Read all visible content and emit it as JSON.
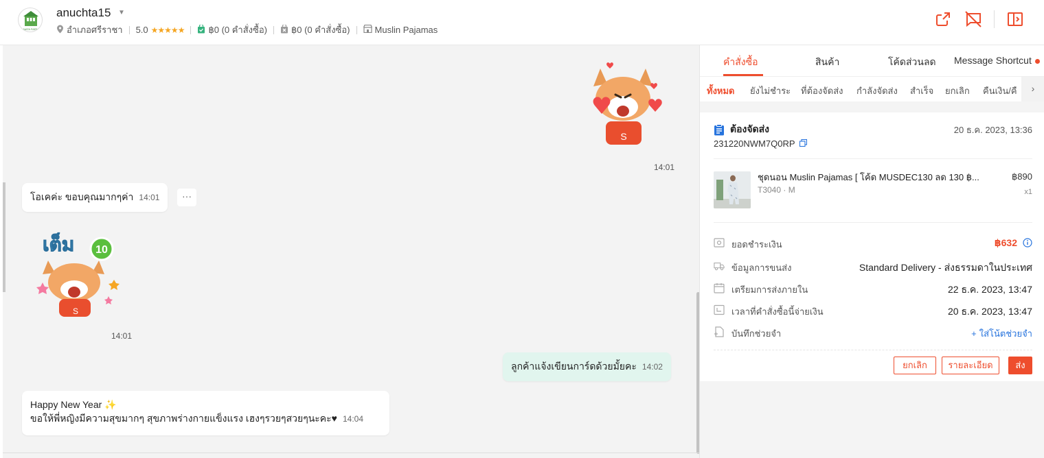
{
  "header": {
    "shop_name": "anuchta15",
    "shop_logo_text": "NATA FARM",
    "location": "อำเภอศรีราชา",
    "rating": "5.0",
    "paid_orders": "฿0 (0 คำสั่งซื้อ)",
    "cancelled_orders": "฿0 (0 คำสั่งซื้อ)",
    "shop_category": "Muslin Pajamas"
  },
  "chat": {
    "messages": [
      {
        "type": "sticker",
        "side": "out",
        "time": "14:01",
        "sticker_text": "S"
      },
      {
        "type": "text",
        "side": "in",
        "text": "โอเคค่ะ ขอบคุณมากๆค่า",
        "time": "14:01"
      },
      {
        "type": "sticker",
        "side": "in",
        "time": "14:01",
        "sticker_text": "เต็ม",
        "sticker_number": "10",
        "sticker_letter": "S"
      },
      {
        "type": "text",
        "side": "out",
        "text": "ลูกค้าแจ้งเขียนการ์ดด้วยมั้ยคะ",
        "time": "14:02"
      },
      {
        "type": "text",
        "side": "in",
        "line1": "Happy New Year ✨",
        "line2": "ขอให้พี่หญิงมีความสุขมากๆ สุขภาพร่างกายแข็งแรง เฮงๆรวยๆสวยๆนะคะ♥",
        "time": "14:04"
      }
    ],
    "more_label": "···"
  },
  "panel": {
    "tabs": [
      {
        "label": "คำสั่งซื้อ",
        "active": true
      },
      {
        "label": "สินค้า",
        "active": false
      },
      {
        "label": "โค้ดส่วนลด",
        "active": false
      },
      {
        "label": "Message Shortcut",
        "active": false
      }
    ],
    "subtabs": [
      {
        "label": "ทั้งหมด",
        "active": true
      },
      {
        "label": "ยังไม่ชำระ",
        "active": false
      },
      {
        "label": "ที่ต้องจัดส่ง",
        "active": false
      },
      {
        "label": "กำลังจัดส่ง",
        "active": false
      },
      {
        "label": "สำเร็จ",
        "active": false
      },
      {
        "label": "ยกเลิก",
        "active": false
      },
      {
        "label": "คืนเงิน/คื",
        "active": false
      }
    ],
    "order": {
      "status": "ต้องจัดส่ง",
      "datetime": "20 ธ.ค. 2023, 13:36",
      "order_id": "231220NWM7Q0RP",
      "product_name": "ชุดนอน Muslin Pajamas [ โค้ด MUSDEC130 ลด 130 ฿...",
      "product_variant": "T3040 · M",
      "product_price": "฿890",
      "product_qty": "x1",
      "rows": [
        {
          "label": "ยอดชำระเงิน",
          "value": "฿632",
          "icon": "payment-icon"
        },
        {
          "label": "ข้อมูลการขนส่ง",
          "value": "Standard Delivery - ส่งธรรมดาในประเทศ",
          "icon": "truck-icon"
        },
        {
          "label": "เตรียมการส่งภายใน",
          "value": "22 ธ.ค. 2023, 13:47",
          "icon": "calendar-icon"
        },
        {
          "label": "เวลาที่คำสั่งซื้อนี้จ่ายเงิน",
          "value": "20 ธ.ค. 2023, 13:47",
          "icon": "clock-calendar-icon"
        },
        {
          "label": "บันทึกช่วยจำ",
          "value": "ใส่โน้ตช่วยจำ",
          "icon": "note-icon"
        }
      ],
      "buttons": {
        "cancel": "ยกเลิก",
        "details": "รายละเอียด",
        "ship": "ส่ง"
      }
    }
  },
  "colors": {
    "accent": "#ee4d2d",
    "outgoing_bubble": "#e1f5ee",
    "chat_bg": "#f3f3f3",
    "star": "#f5a623",
    "link_blue": "#2673dd"
  }
}
